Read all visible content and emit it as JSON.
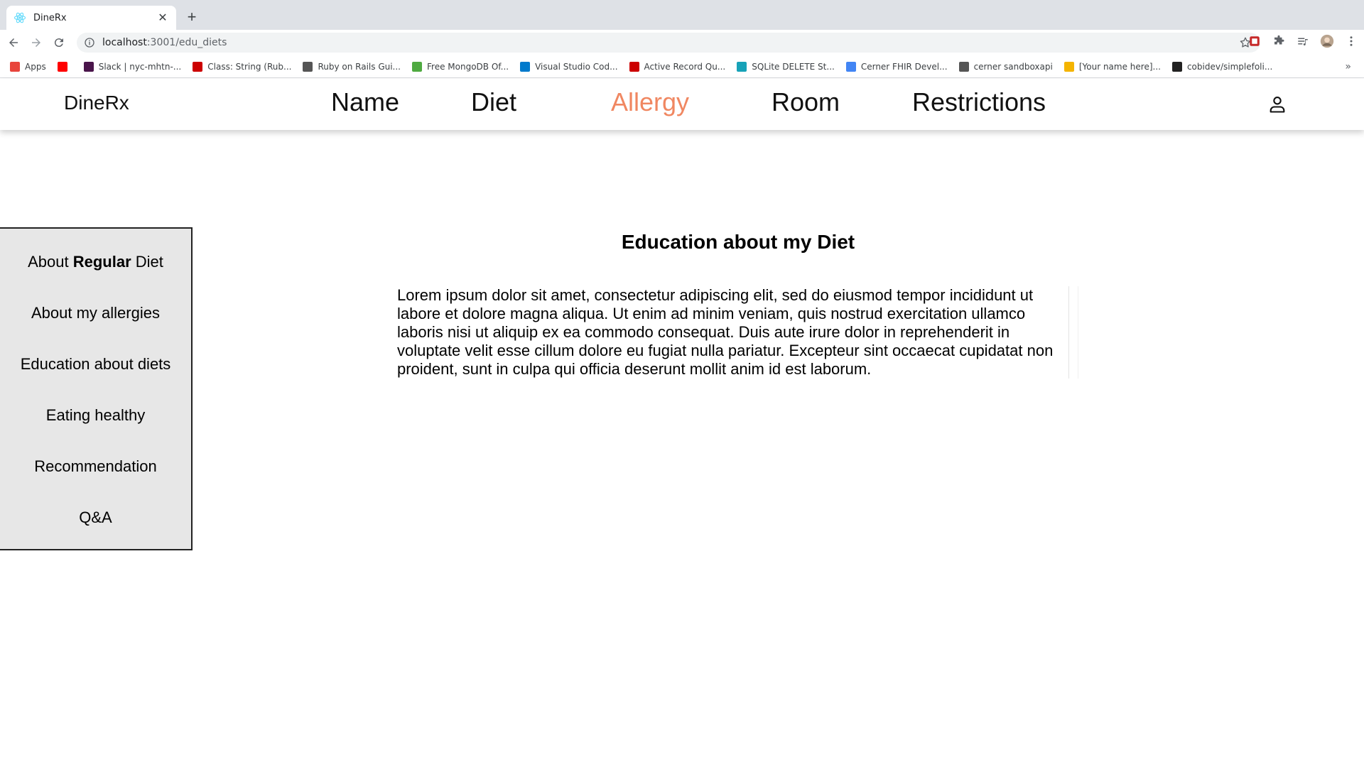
{
  "browser": {
    "tab_title": "DineRx",
    "url_host": "localhost",
    "url_rest": ":3001/edu_diets",
    "bookmarks": [
      {
        "label": "Apps",
        "color": "#e8453c"
      },
      {
        "label": "",
        "color": "#ff0000"
      },
      {
        "label": "Slack | nyc-mhtn-...",
        "color": "#4a154b"
      },
      {
        "label": "Class: String (Rub...",
        "color": "#cc0000"
      },
      {
        "label": "Ruby on Rails Gui...",
        "color": "#555555"
      },
      {
        "label": "Free MongoDB Of...",
        "color": "#4faa41"
      },
      {
        "label": "Visual Studio Cod...",
        "color": "#007acc"
      },
      {
        "label": "Active Record Qu...",
        "color": "#cc0000"
      },
      {
        "label": "SQLite DELETE St...",
        "color": "#17a2b8"
      },
      {
        "label": "Cerner FHIR Devel...",
        "color": "#4285f4"
      },
      {
        "label": "cerner sandboxapi",
        "color": "#555555"
      },
      {
        "label": "[Your name here]...",
        "color": "#f4b400"
      },
      {
        "label": "cobidev/simplefoli...",
        "color": "#222222"
      }
    ],
    "more_symbol": "»"
  },
  "app": {
    "brand": "DineRx",
    "nav": [
      {
        "label": "Name",
        "active": false
      },
      {
        "label": "Diet",
        "active": false
      },
      {
        "label": "Allergy",
        "active": true
      },
      {
        "label": "Room",
        "active": false
      },
      {
        "label": "Restrictions",
        "active": false
      }
    ],
    "accent_color": "#f08761"
  },
  "sidebar": {
    "items": [
      {
        "prefix": "About ",
        "bold": "Regular",
        "suffix": " Diet"
      },
      {
        "prefix": "About my allergies",
        "bold": "",
        "suffix": ""
      },
      {
        "prefix": "Education about diets",
        "bold": "",
        "suffix": ""
      },
      {
        "prefix": "Eating healthy",
        "bold": "",
        "suffix": ""
      },
      {
        "prefix": "Recommendation",
        "bold": "",
        "suffix": ""
      },
      {
        "prefix": "Q&A",
        "bold": "",
        "suffix": ""
      }
    ]
  },
  "main": {
    "title": "Education about my Diet",
    "paragraph": "Lorem ipsum dolor sit amet, consectetur adipiscing elit, sed do eiusmod tempor incididunt ut labore et dolore magna aliqua. Ut enim ad minim veniam, quis nostrud exercitation ullamco laboris nisi ut aliquip ex ea commodo consequat. Duis aute irure dolor in reprehenderit in voluptate velit esse cillum dolore eu fugiat nulla pariatur. Excepteur sint occaecat cupidatat non proident, sunt in culpa qui officia deserunt mollit anim id est laborum."
  }
}
